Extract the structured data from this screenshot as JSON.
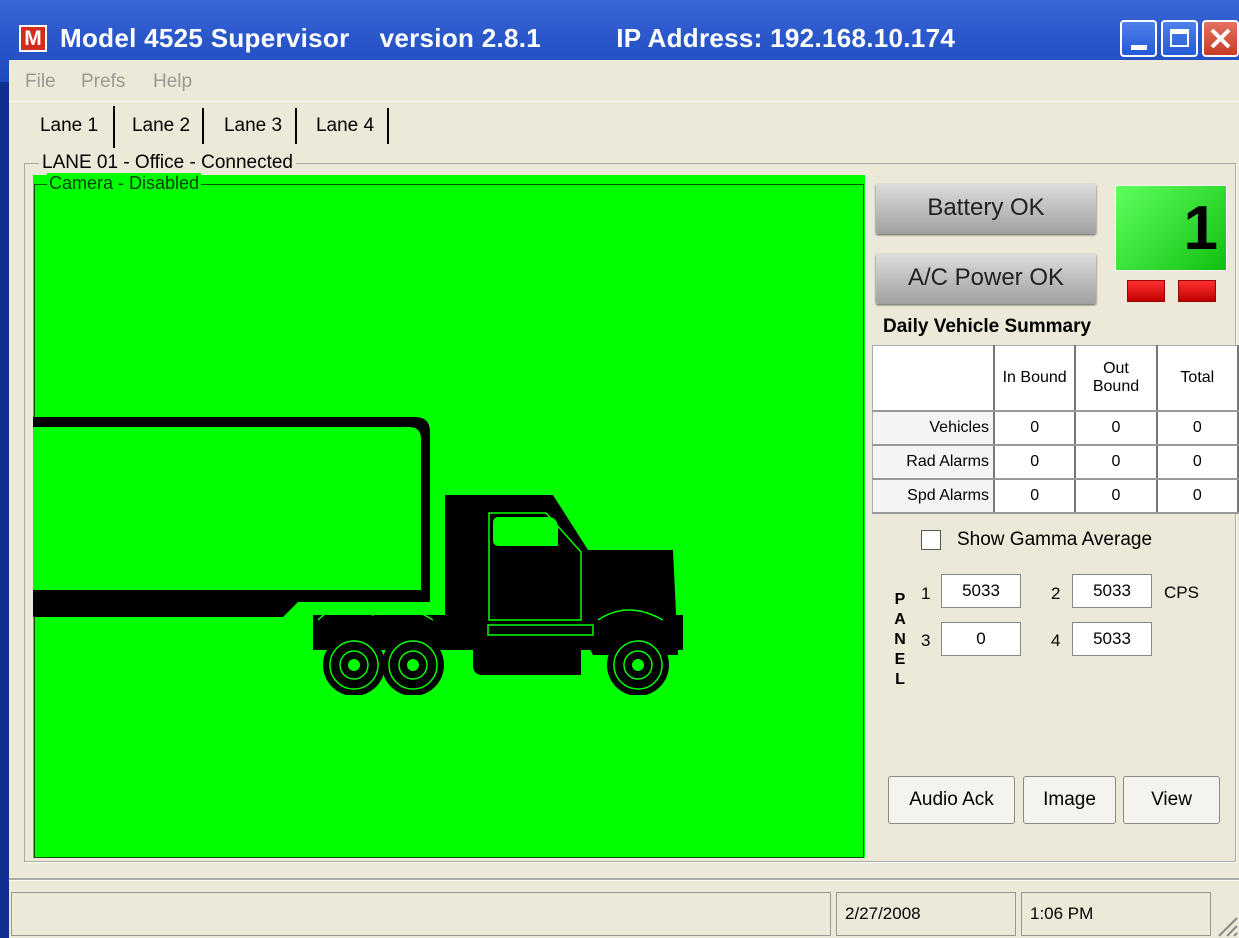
{
  "window": {
    "app_icon": "M",
    "title": "Model 4525 Supervisor    version 2.8.1          IP Address: 192.168.10.174",
    "minimize_icon": "minimize-icon",
    "maximize_icon": "maximize-icon",
    "close_icon": "close-icon"
  },
  "menu": {
    "file": "File",
    "prefs": "Prefs",
    "help": "Help"
  },
  "tabs": [
    {
      "label": "Lane 1"
    },
    {
      "label": "Lane 2"
    },
    {
      "label": "Lane 3"
    },
    {
      "label": "Lane 4"
    }
  ],
  "lane_group": {
    "label": "LANE 01 - Office - Connected"
  },
  "camera": {
    "label": "Camera - Disabled",
    "background": "#00ff00"
  },
  "status_buttons": {
    "battery": "Battery OK",
    "ac_power": "A/C Power OK"
  },
  "indicator": {
    "value": "1",
    "color": "#22dd22",
    "led_color": "#e00000"
  },
  "summary": {
    "title": "Daily Vehicle Summary",
    "columns": [
      "In Bound",
      "Out Bound",
      "Total"
    ],
    "column_out_line1": "Out",
    "column_out_line2": "Bound",
    "rows": [
      {
        "label": "Vehicles",
        "in": "0",
        "out": "0",
        "total": "0"
      },
      {
        "label": "Rad Alarms",
        "in": "0",
        "out": "0",
        "total": "0"
      },
      {
        "label": "Spd Alarms",
        "in": "0",
        "out": "0",
        "total": "0"
      }
    ]
  },
  "gamma": {
    "label": "Show Gamma Average",
    "checked": false
  },
  "panel": {
    "letters": [
      "P",
      "A",
      "N",
      "E",
      "L"
    ],
    "channels": [
      {
        "num": "1",
        "value": "5033"
      },
      {
        "num": "2",
        "value": "5033"
      },
      {
        "num": "3",
        "value": "0"
      },
      {
        "num": "4",
        "value": "5033"
      }
    ],
    "unit": "CPS"
  },
  "actions": {
    "audio_ack": "Audio Ack",
    "image": "Image",
    "view": "View"
  },
  "statusbar": {
    "message": "",
    "date": "2/27/2008",
    "time": "1:06 PM"
  }
}
